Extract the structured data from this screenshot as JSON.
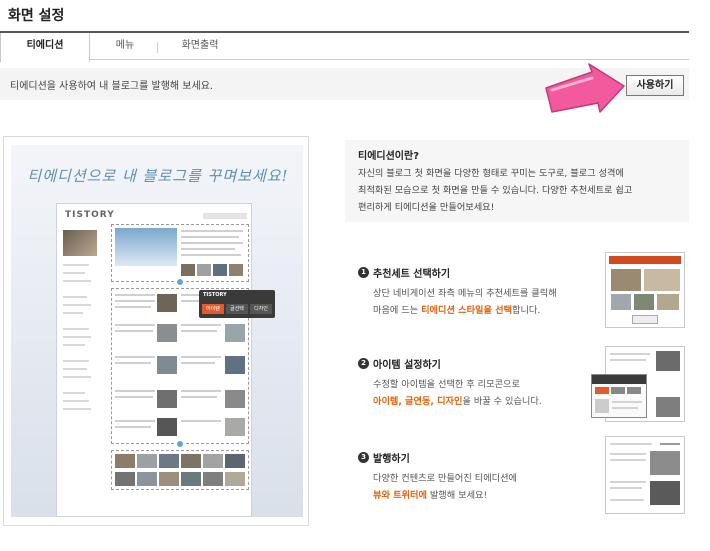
{
  "page": {
    "title": "화면 설정"
  },
  "tabs": [
    {
      "label": "티에디션",
      "active": true
    },
    {
      "label": "메뉴",
      "active": false
    },
    {
      "label": "화면출력",
      "active": false
    }
  ],
  "notice": {
    "text": "티에디션을 사용하여 내 블로그를 발행해 보세요.",
    "button_label": "사용하기"
  },
  "preview": {
    "headline": "티에디션으로 내 블로그를 꾸며보세요!",
    "mock_logo": "TISTORY",
    "popup": {
      "title": "TISTORY",
      "tabs": [
        "아이템",
        "글선택",
        "디자인"
      ]
    }
  },
  "intro": {
    "title": "티에디션이란?",
    "lines": [
      "자신의 블로그 첫 화면을 다양한 형태로 꾸미는 도구로, 블로그 성격에",
      "최적화된 모습으로 첫 화면을 만들 수 있습니다. 다양한 추천세트로 쉽고",
      "편리하게 티에디션을 만들어보세요!"
    ]
  },
  "steps": [
    {
      "number": "1",
      "title": "추천세트 선택하기",
      "line1": "상단 네비게이션 좌측 메뉴의 추천세트를 클릭해",
      "line2_pre": "마음에 드는 ",
      "line2_hl": "티에디션 스타일을 선택",
      "line2_post": "합니다."
    },
    {
      "number": "2",
      "title": "아이템 설정하기",
      "line1": "수정할 아이템을 선택한 후 리모콘으로",
      "line2_pre": "",
      "line2_hl": "아이템, 글연동, 디자인",
      "line2_post": "을 바꿀 수 있습니다."
    },
    {
      "number": "3",
      "title": "발행하기",
      "line1": "다양한 컨텐츠로 만들어진 티에디션에",
      "line2_pre": "",
      "line2_hl": "뷰와 트위터에",
      "line2_post": " 발행해 보세요!"
    }
  ],
  "colors": {
    "accent": "#e2630e",
    "arrow": "#f25a9d",
    "popup_active": "#e15b2c"
  }
}
